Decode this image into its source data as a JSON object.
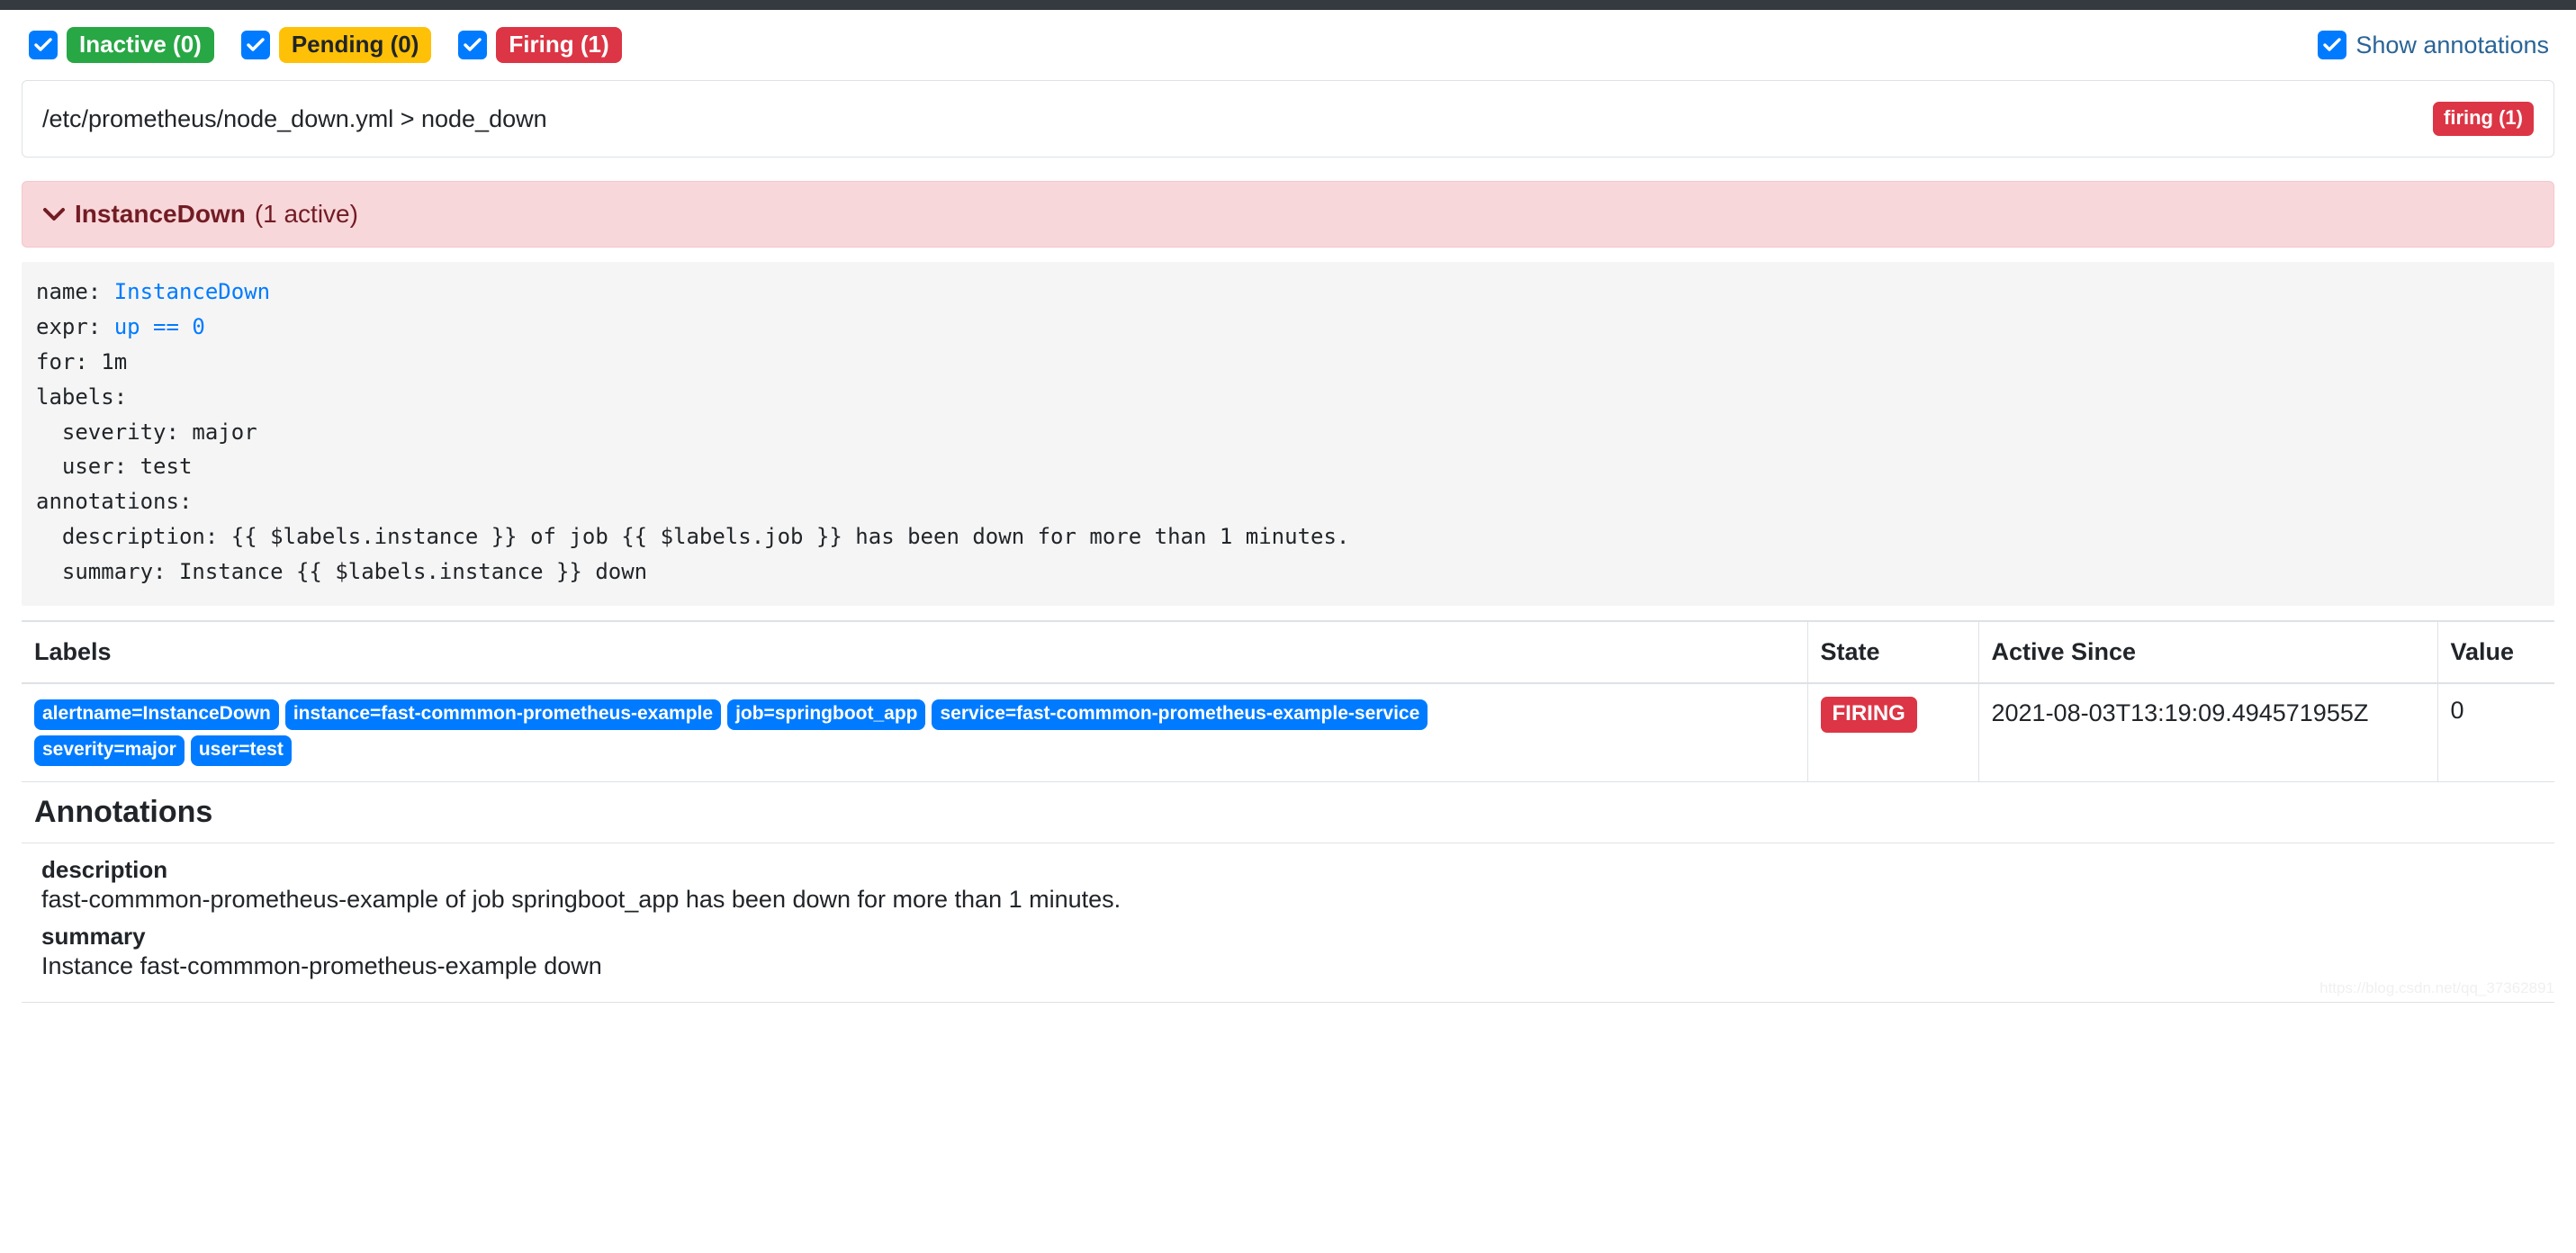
{
  "filters": [
    {
      "name": "inactive",
      "label": "Inactive (0)",
      "color": "#28a745",
      "checked": true
    },
    {
      "name": "pending",
      "label": "Pending (0)",
      "color": "#ffc107",
      "checked": true
    },
    {
      "name": "firing",
      "label": "Firing (1)",
      "color": "#dc3545",
      "checked": true
    }
  ],
  "show_annotations": {
    "label": "Show annotations",
    "checked": true
  },
  "group": {
    "path": "/etc/prometheus/node_down.yml > node_down",
    "state_badge": "firing (1)"
  },
  "alert": {
    "name": "InstanceDown",
    "active_text": "(1 active)",
    "rule": {
      "name_key": "name: ",
      "name_value": "InstanceDown",
      "expr_key": "expr: ",
      "expr_value": "up == 0",
      "for_line": "for: 1m",
      "labels_line": "labels:",
      "labels_severity": "  severity: major",
      "labels_user": "  user: test",
      "annotations_line": "annotations:",
      "ann_description": "  description: {{ $labels.instance }} of job {{ $labels.job }} has been down for more than 1 minutes.",
      "ann_summary": "  summary: Instance {{ $labels.instance }} down"
    }
  },
  "table": {
    "headers": [
      "Labels",
      "State",
      "Active Since",
      "Value"
    ],
    "rows": [
      {
        "labels": [
          "alertname=InstanceDown",
          "instance=fast-commmon-prometheus-example",
          "job=springboot_app",
          "service=fast-commmon-prometheus-example-service",
          "severity=major",
          "user=test"
        ],
        "state": "FIRING",
        "active_since": "2021-08-03T13:19:09.494571955Z",
        "value": "0"
      }
    ]
  },
  "annotations": {
    "title": "Annotations",
    "items": [
      {
        "key": "description",
        "value": "fast-commmon-prometheus-example of job springboot_app has been down for more than 1 minutes."
      },
      {
        "key": "summary",
        "value": "Instance fast-commmon-prometheus-example down"
      }
    ]
  },
  "watermark": "https://blog.csdn.net/qq_37362891"
}
